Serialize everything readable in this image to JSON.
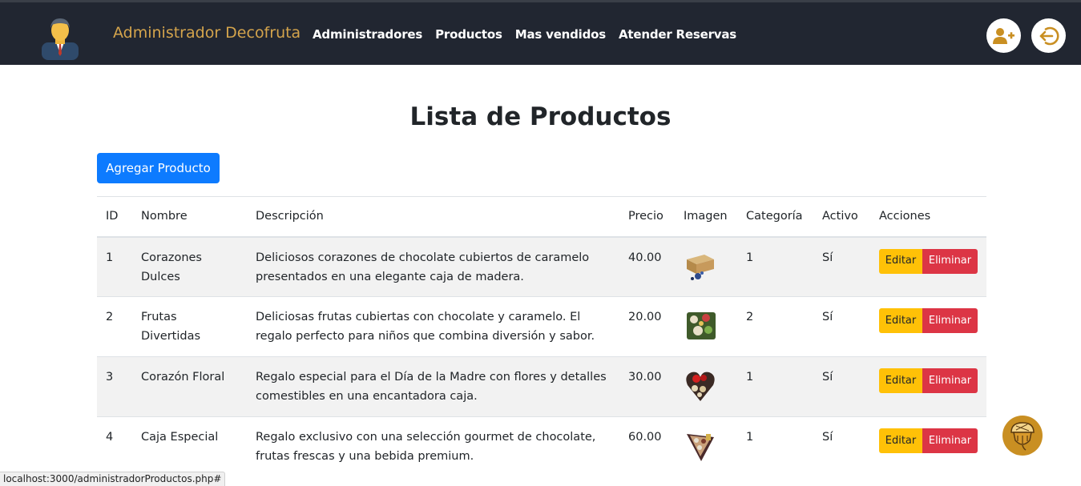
{
  "header": {
    "brand_title": "Administrador Decofruta",
    "nav": [
      "Administradores",
      "Productos",
      "Mas vendidos",
      "Atender Reservas"
    ],
    "icons": {
      "avatar": "admin-avatar-icon",
      "add_user": "user-plus-icon",
      "logout": "sign-out-icon"
    },
    "colors": {
      "bar": "#212631",
      "brand": "#d4a44c",
      "icon_accent": "#c98f22"
    }
  },
  "main": {
    "title": "Lista de Productos",
    "add_button": "Agregar Producto"
  },
  "table": {
    "columns": [
      "ID",
      "Nombre",
      "Descripción",
      "Precio",
      "Imagen",
      "Categoría",
      "Activo",
      "Acciones"
    ],
    "rows": [
      {
        "id": "1",
        "nombre": "Corazones Dulces",
        "descripcion": "Deliciosos corazones de chocolate cubiertos de caramelo presentados en una elegante caja de madera.",
        "precio": "40.00",
        "imagen": "wooden-box-thumbnail",
        "categoria": "1",
        "activo": "Sí",
        "editar": "Editar",
        "eliminar": "Eliminar"
      },
      {
        "id": "2",
        "nombre": "Frutas Divertidas",
        "descripcion": "Deliciosas frutas cubiertas con chocolate y caramelo. El regalo perfecto para niños que combina diversión y sabor.",
        "precio": "20.00",
        "imagen": "fruit-tray-thumbnail",
        "categoria": "2",
        "activo": "Sí",
        "editar": "Editar",
        "eliminar": "Eliminar"
      },
      {
        "id": "3",
        "nombre": "Corazón Floral",
        "descripcion": "Regalo especial para el Día de la Madre con flores y detalles comestibles en una encantadora caja.",
        "precio": "30.00",
        "imagen": "heart-box-thumbnail",
        "categoria": "1",
        "activo": "Sí",
        "editar": "Editar",
        "eliminar": "Eliminar"
      },
      {
        "id": "4",
        "nombre": "Caja Especial",
        "descripcion": "Regalo exclusivo con una selección gourmet de chocolate, frutas frescas y una bebida premium.",
        "precio": "60.00",
        "imagen": "gourmet-box-thumbnail",
        "categoria": "1",
        "activo": "Sí",
        "editar": "Editar",
        "eliminar": "Eliminar"
      }
    ]
  },
  "floating": {
    "icon": "acorn-icon"
  },
  "statusbar": {
    "url": "localhost:3000/administradorProductos.php#"
  }
}
